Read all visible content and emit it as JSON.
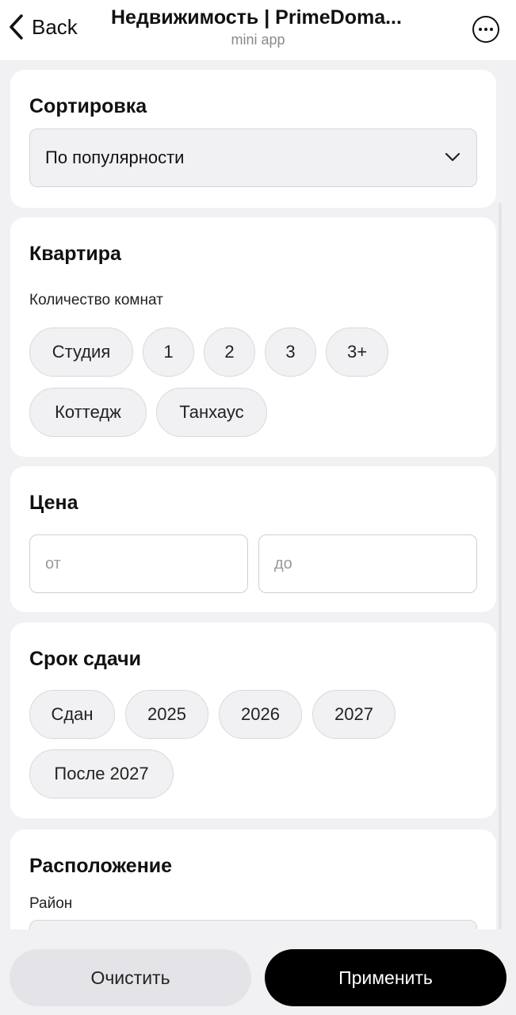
{
  "header": {
    "back_label": "Back",
    "title": "Недвижимость | PrimeDoma...",
    "subtitle": "mini app"
  },
  "sort": {
    "title": "Сортировка",
    "selected": "По популярности"
  },
  "apartment": {
    "title": "Квартира",
    "rooms_label": "Количество комнат",
    "options": [
      "Студия",
      "1",
      "2",
      "3",
      "3+",
      "Коттедж",
      "Танхаус"
    ]
  },
  "price": {
    "title": "Цена",
    "from_placeholder": "от",
    "to_placeholder": "до"
  },
  "delivery": {
    "title": "Срок сдачи",
    "options": [
      "Сдан",
      "2025",
      "2026",
      "2027",
      "После 2027"
    ]
  },
  "location": {
    "title": "Расположение",
    "district_label": "Район"
  },
  "actions": {
    "clear_label": "Очистить",
    "apply_label": "Применить"
  }
}
